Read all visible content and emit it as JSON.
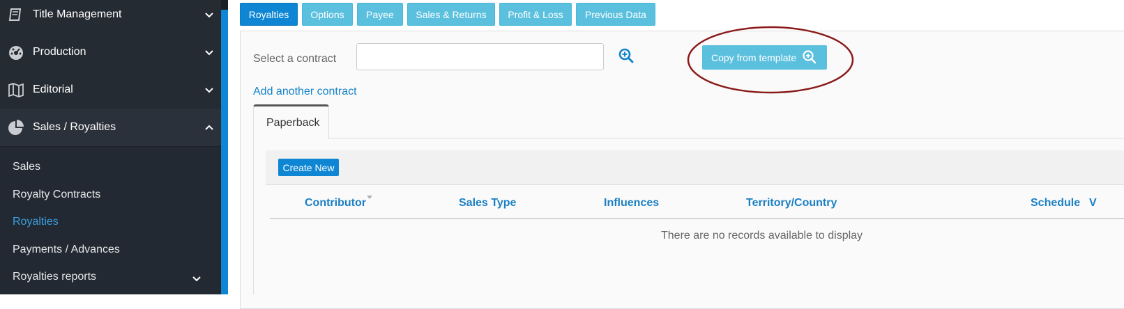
{
  "sidebar": {
    "main_items": [
      {
        "label": "Title Management",
        "icon": "book-icon"
      },
      {
        "label": "Production",
        "icon": "dashboard-gauge-icon"
      },
      {
        "label": "Editorial",
        "icon": "map-icon"
      },
      {
        "label": "Sales / Royalties",
        "icon": "pie-chart-icon"
      }
    ],
    "sub_items": [
      {
        "label": "Sales"
      },
      {
        "label": "Royalty Contracts"
      },
      {
        "label": "Royalties"
      },
      {
        "label": "Payments / Advances"
      },
      {
        "label": "Royalties reports"
      }
    ]
  },
  "top_tabs": [
    "Royalties",
    "Options",
    "Payee",
    "Sales & Returns",
    "Profit & Loss",
    "Previous Data"
  ],
  "contract": {
    "label": "Select a contract",
    "value": "",
    "search_icon": "magnifier-plus-icon"
  },
  "copy_template": {
    "label": "Copy from template",
    "icon": "magnifier-plus-icon"
  },
  "add_contract_link": "Add another contract",
  "format_tabs": [
    "Paperback"
  ],
  "table": {
    "create_label": "Create New",
    "columns": [
      "Contributor",
      "Sales Type",
      "Influences",
      "Territory/Country",
      "Schedule",
      "V"
    ],
    "empty_message": "There are no records available to display"
  },
  "colors": {
    "sidebar_bg": "#232932",
    "primary": "#0e86d4",
    "info": "#5bc0de",
    "annotation": "#8b1a1a",
    "active_link": "#3a9fe0"
  }
}
